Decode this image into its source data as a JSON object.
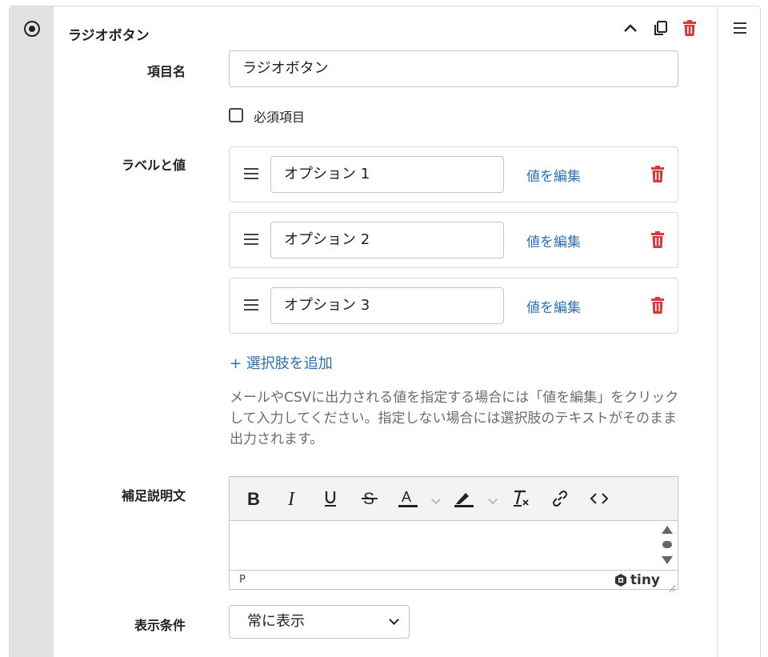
{
  "field": {
    "title": "ラジオボタン",
    "icons": {
      "collapse": "chevron-up-icon",
      "duplicate": "copy-icon",
      "delete": "trash-icon",
      "menu": "hamburger-menu-icon",
      "type": "radio-button-icon"
    }
  },
  "item_name": {
    "label": "項目名",
    "value": "ラジオボタン"
  },
  "required": {
    "label": "必須項目",
    "checked": false
  },
  "options": {
    "label": "ラベルと値",
    "items": [
      {
        "value": "オプション 1",
        "edit_label": "値を編集"
      },
      {
        "value": "オプション 2",
        "edit_label": "値を編集"
      },
      {
        "value": "オプション 3",
        "edit_label": "値を編集"
      }
    ],
    "add_label": "+ 選択肢を追加",
    "help_text": "メールやCSVに出力される値を指定する場合には「値を編集」をクリックして入力してください。指定しない場合には選択肢のテキストがそのまま出力されます。"
  },
  "description": {
    "label": "補足説明文",
    "toolbar": [
      "bold",
      "italic",
      "underline",
      "strikethrough",
      "text-color",
      "highlight-color",
      "clear-formatting",
      "link",
      "source-code"
    ],
    "path": "P",
    "brand": "tiny"
  },
  "display_condition": {
    "label": "表示条件",
    "selected": "常に表示"
  },
  "colors": {
    "link": "#2c6fb0",
    "danger": "#d63a3a",
    "strip": "#e2e2e2"
  }
}
